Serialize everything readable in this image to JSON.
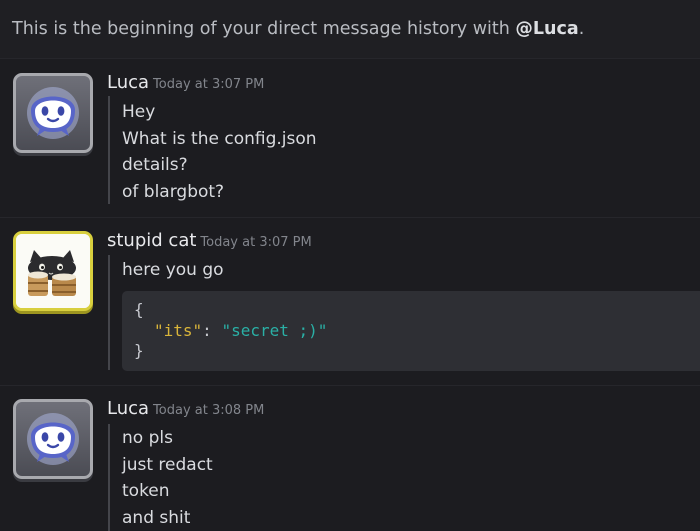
{
  "intro": {
    "text": "This is the beginning of your direct message history with ",
    "mention": "@Luca",
    "end": "."
  },
  "messages": [
    {
      "author": "Luca",
      "timestamp": "Today at 3:07 PM",
      "avatar_icon": "discord-blob-icon",
      "lines": [
        "Hey",
        "What is the config.json",
        "details?",
        "of blargbot?"
      ]
    },
    {
      "author": "stupid cat",
      "timestamp": "Today at 3:07 PM",
      "avatar_icon": "cat-bongo-drums-icon",
      "lines": [
        "here you go"
      ],
      "code": {
        "open": "{",
        "key": "\"its\"",
        "colon": ": ",
        "value": "\"secret ;)\"",
        "close": "}"
      }
    },
    {
      "author": "Luca",
      "timestamp": "Today at 3:08 PM",
      "avatar_icon": "discord-blob-icon",
      "lines": [
        "no pls",
        "just redact",
        "token",
        "and shit"
      ]
    }
  ],
  "colors": {
    "background": "#1c1c20",
    "text": "#d9dbdf",
    "timestamp": "#82858c",
    "code_background": "#2e2f34",
    "code_key": "#d9b53a",
    "code_string": "#2ab0a6"
  }
}
